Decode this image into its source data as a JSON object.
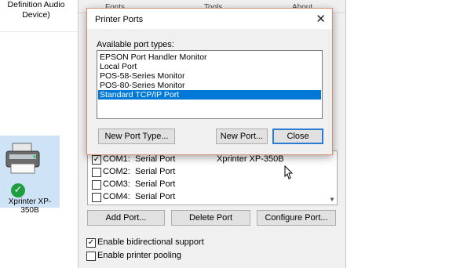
{
  "background": {
    "device_title": "Definition Audio\nDevice)",
    "device_label": "Xprinter XP-350B",
    "tabs": [
      "Fonts",
      "Tools",
      "About"
    ]
  },
  "properties": {
    "ports": [
      {
        "checked": true,
        "name": "COM1:",
        "desc": "Serial Port",
        "printer": "Xprinter XP-350B"
      },
      {
        "checked": false,
        "name": "COM2:",
        "desc": "Serial Port",
        "printer": ""
      },
      {
        "checked": false,
        "name": "COM3:",
        "desc": "Serial Port",
        "printer": ""
      },
      {
        "checked": false,
        "name": "COM4:",
        "desc": "Serial Port",
        "printer": ""
      }
    ],
    "buttons": {
      "add": "Add Port...",
      "delete": "Delete Port",
      "configure": "Configure Port..."
    },
    "options": {
      "bidirectional": {
        "label": "Enable bidirectional support",
        "checked": true
      },
      "pooling": {
        "label": "Enable printer pooling",
        "checked": false
      }
    }
  },
  "dialog": {
    "title": "Printer Ports",
    "label": "Available port types:",
    "port_types": [
      "EPSON Port Handler Monitor",
      "Local Port",
      "POS-58-Series Monitor",
      "POS-80-Series Monitor",
      "Standard TCP/IP Port"
    ],
    "selected_index": 4,
    "buttons": {
      "new_type": "New Port Type...",
      "new_port": "New Port...",
      "close": "Close"
    },
    "close_glyph": "✕"
  },
  "colors": {
    "selection": "#0078d7",
    "accent_border": "#2a7ad3",
    "success": "#1e9e3e"
  }
}
